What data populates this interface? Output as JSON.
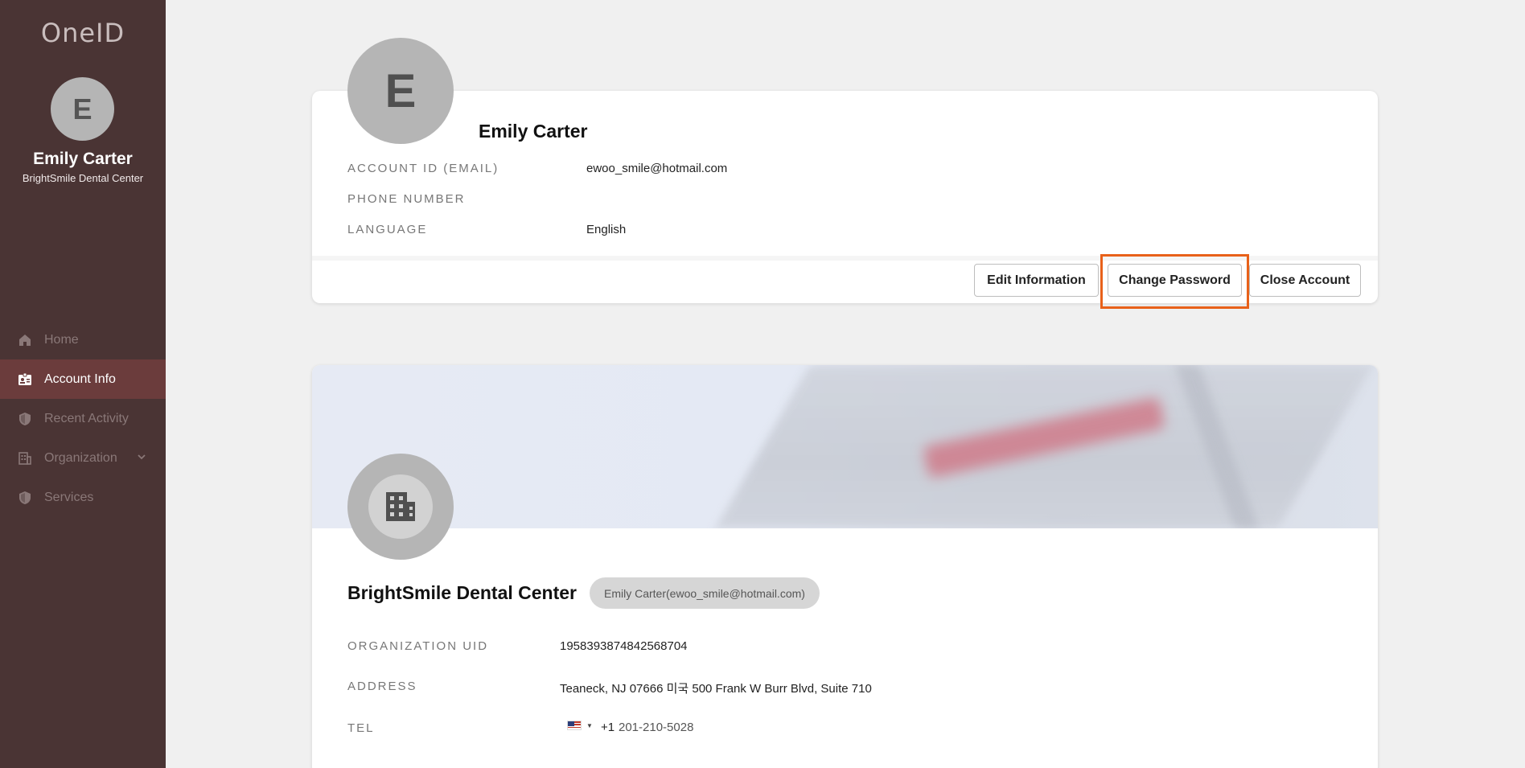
{
  "app": {
    "logo": "OneID"
  },
  "sidebar": {
    "avatar_letter": "E",
    "user_name": "Emily Carter",
    "org_name": "BrightSmile Dental Center",
    "items": [
      {
        "label": "Home",
        "icon": "home-icon",
        "active": false
      },
      {
        "label": "Account Info",
        "icon": "id-card-icon",
        "active": true
      },
      {
        "label": "Recent Activity",
        "icon": "shield-icon",
        "active": false
      },
      {
        "label": "Organization",
        "icon": "building-icon",
        "active": false,
        "has_submenu": true
      },
      {
        "label": "Services",
        "icon": "shield-icon",
        "active": false
      }
    ]
  },
  "account": {
    "avatar_letter": "E",
    "name": "Emily Carter",
    "fields": {
      "email_label": "ACCOUNT ID (EMAIL)",
      "email_value": "ewoo_smile@hotmail.com",
      "phone_label": "PHONE NUMBER",
      "phone_value": "",
      "language_label": "LANGUAGE",
      "language_value": "English"
    },
    "buttons": {
      "edit": "Edit Information",
      "change_password": "Change Password",
      "close": "Close Account"
    },
    "highlight_color": "#e8611a"
  },
  "organization": {
    "name": "BrightSmile Dental Center",
    "owner": "Emily Carter(ewoo_smile@hotmail.com)",
    "uid_label": "ORGANIZATION UID",
    "uid_value": "1958393874842568704",
    "address_label": "ADDRESS",
    "address_value": "Teaneck, NJ 07666 미국 500 Frank W Burr Blvd, Suite 710",
    "tel_label": "TEL",
    "tel_country_code": "+1",
    "tel_number": "201-210-5028"
  },
  "colors": {
    "sidebar_bg": "#4a3434",
    "sidebar_active": "#6b3c3c"
  }
}
